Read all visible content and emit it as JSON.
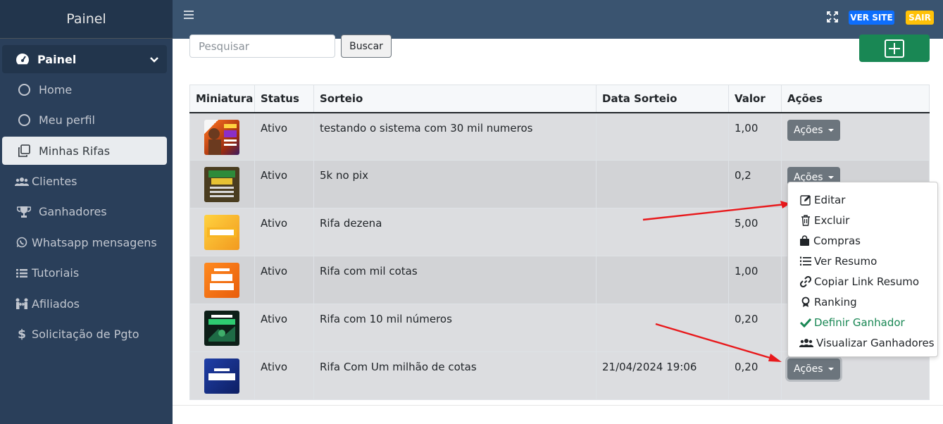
{
  "sidebar": {
    "brand": "Painel",
    "head": {
      "label": "Painel",
      "icon": "dashboard-gauge-icon"
    },
    "items": [
      {
        "label": "Home",
        "icon": "circle-icon"
      },
      {
        "label": "Meu perfil",
        "icon": "circle-icon"
      },
      {
        "label": "Minhas Rifas",
        "icon": "copy-icon",
        "active": true
      },
      {
        "label": "Clientes",
        "icon": "users-icon"
      },
      {
        "label": "Ganhadores",
        "icon": "trophy-icon"
      },
      {
        "label": "Whatsapp mensagens",
        "icon": "whatsapp-icon"
      },
      {
        "label": "Tutoriais",
        "icon": "list-icon"
      },
      {
        "label": "Afiliados",
        "icon": "people-arrows-icon"
      },
      {
        "label": "Solicitação de Pgto",
        "icon": "dollar-icon"
      }
    ]
  },
  "topbar": {
    "ver_site": "VER SITE",
    "sair": "SAIR",
    "colors": {
      "bar": "#3a5470",
      "ver_site": "#0d6efd",
      "sair": "#ffc107"
    }
  },
  "search": {
    "placeholder": "Pesquisar",
    "button": "Buscar"
  },
  "table": {
    "headers": [
      "Miniatura",
      "Status",
      "Sorteio",
      "Data Sorteio",
      "Valor",
      "Ações"
    ],
    "rows": [
      {
        "status": "Ativo",
        "sorteio": "testando o sistema com 30 mil numeros",
        "data": "",
        "valor": "1,00",
        "acoes": "Ações",
        "thumb_text": ""
      },
      {
        "status": "Ativo",
        "sorteio": "5k no pix",
        "data": "",
        "valor": "0,2",
        "acoes": "Ações",
        "thumb_text": "R$ 5.000 NO PIX"
      },
      {
        "status": "Ativo",
        "sorteio": "Rifa dezena",
        "data": "",
        "valor": "5,00",
        "acoes": "Ações",
        "thumb_text": "DEZENA"
      },
      {
        "status": "Ativo",
        "sorteio": "Rifa com mil cotas",
        "data": "",
        "valor": "1,00",
        "acoes": "Ações",
        "thumb_text": "MODELO EXIBE NÚMEROS"
      },
      {
        "status": "Ativo",
        "sorteio": "Rifa com 10 mil números",
        "data": "",
        "valor": "0,20",
        "acoes": "Ações",
        "thumb_text": "LIMPADAH"
      },
      {
        "status": "Ativo",
        "sorteio": "Rifa Com Um milhão de cotas",
        "data": "21/04/2024 19:06",
        "valor": "0,20",
        "acoes": "Ações",
        "thumb_text": "MODELO ALEATÓRIO"
      }
    ]
  },
  "dropdown": {
    "items": [
      {
        "label": "Editar",
        "icon": "edit-icon"
      },
      {
        "label": "Excluir",
        "icon": "trash-icon"
      },
      {
        "label": "Compras",
        "icon": "shopping-bag-icon"
      },
      {
        "label": "Ver Resumo",
        "icon": "list-ol-icon"
      },
      {
        "label": "Copiar Link Resumo",
        "icon": "link-icon"
      },
      {
        "label": "Ranking",
        "icon": "award-icon"
      },
      {
        "label": "Definir Ganhador",
        "icon": "check-icon",
        "color": "#198754"
      },
      {
        "label": "Visualizar Ganhadores",
        "icon": "users-icon"
      }
    ]
  }
}
